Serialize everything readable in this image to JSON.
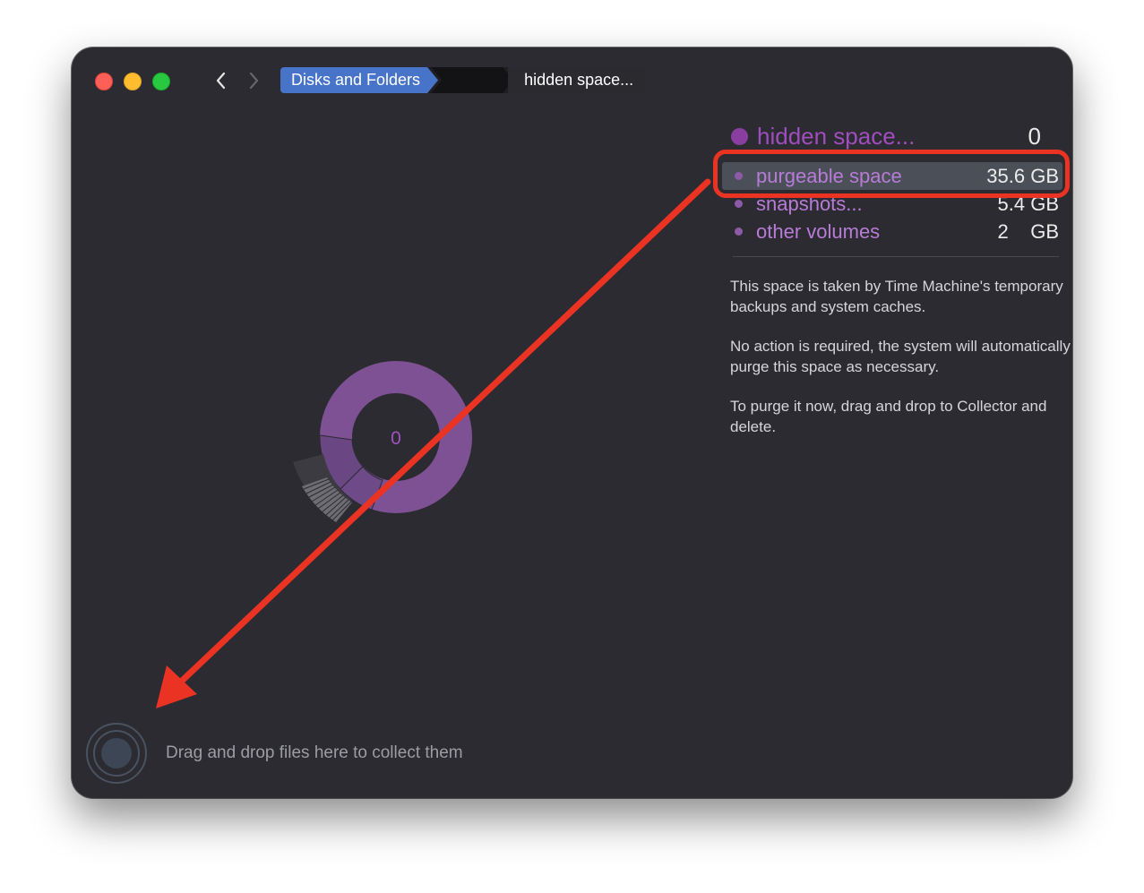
{
  "titlebar": {
    "traffic_lights": [
      "close",
      "minimize",
      "zoom"
    ],
    "nav": {
      "back_icon": "chevron-left-icon",
      "forward_icon": "chevron-right-icon"
    }
  },
  "breadcrumb": {
    "items": [
      {
        "label": "Disks and Folders"
      },
      {
        "label": ""
      },
      {
        "label": "hidden space..."
      }
    ]
  },
  "legend": {
    "header": {
      "label": "hidden space...",
      "value": "0"
    },
    "items": [
      {
        "label": "purgeable space",
        "value": "35.6 GB",
        "selected": true
      },
      {
        "label": "snapshots...",
        "value": "5.4 GB",
        "selected": false
      },
      {
        "label": "other volumes",
        "value": "2    GB",
        "selected": false
      }
    ]
  },
  "description": {
    "paragraphs": [
      "This space is taken by Time Machine's temporary backups and system caches.",
      "No action is required, the system will automatically purge this space as necessary.",
      "To purge it now, drag and drop to Collector and delete."
    ]
  },
  "chart": {
    "center_label": "0"
  },
  "collector": {
    "hint": "Drag and drop files here to collect them",
    "icon": "collector-target-icon"
  },
  "colors": {
    "window_bg": "#2b2b31",
    "accent_purple": "#7e5194",
    "breadcrumb_active": "#4774c9",
    "annotation_red": "#ea3323"
  }
}
